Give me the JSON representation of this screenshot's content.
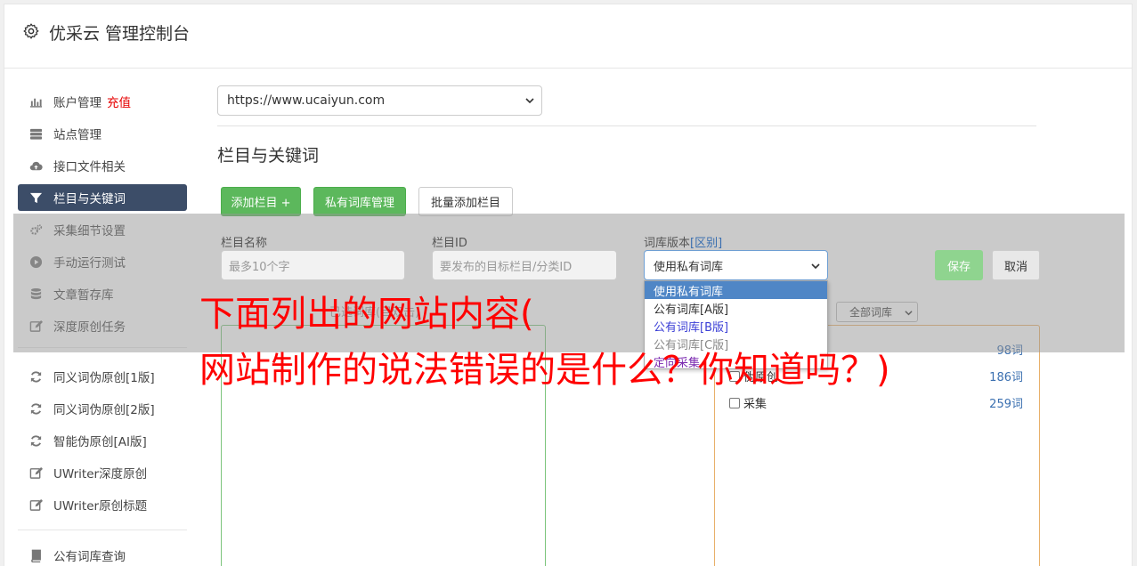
{
  "header": {
    "title": "优采云 管理控制台"
  },
  "sidebar": {
    "items": [
      {
        "label": "账户管理",
        "extra": "充值",
        "icon": "bar-chart-icon"
      },
      {
        "label": "站点管理",
        "icon": "server-icon"
      },
      {
        "label": "接口文件相关",
        "icon": "cloud-upload-icon"
      },
      {
        "label": "栏目与关键词",
        "icon": "filter-icon",
        "active": true
      },
      {
        "label": "采集细节设置",
        "icon": "gears-icon"
      },
      {
        "label": "手动运行测试",
        "icon": "play-circle-icon"
      },
      {
        "label": "文章暂存库",
        "icon": "database-icon"
      },
      {
        "label": "深度原创任务",
        "icon": "edit-icon"
      },
      {
        "label": "同义词伪原创[1版]",
        "icon": "refresh-icon"
      },
      {
        "label": "同义词伪原创[2版]",
        "icon": "refresh-icon"
      },
      {
        "label": "智能伪原创[AI版]",
        "icon": "refresh-icon"
      },
      {
        "label": "UWriter深度原创",
        "icon": "edit-icon"
      },
      {
        "label": "UWriter原创标题",
        "icon": "edit-icon"
      },
      {
        "label": "公有词库查询",
        "icon": "book-icon"
      }
    ]
  },
  "main": {
    "site_select": "https://www.ucaiyun.com",
    "section_title": "栏目与关键词",
    "buttons": {
      "add_column": "添加栏目 +",
      "private_lib": "私有词库管理",
      "batch_add": "批量添加栏目"
    },
    "form": {
      "name_label": "栏目名称",
      "name_placeholder": "最多10个字",
      "id_label": "栏目ID",
      "id_placeholder": "要发布的目标栏目/分类ID",
      "lib_label": "词库版本",
      "lib_label_link": "[区别]",
      "lib_value": "使用私有词库",
      "save": "保存",
      "cancel": "取消"
    },
    "lib_options": [
      "使用私有词库",
      "公有词库[A版]",
      "公有词库[B版]",
      "公有词库[C版]",
      "定向采集"
    ],
    "faded_label": "已选词库(目双击)",
    "lib_filter": "全部词库",
    "lib_list": [
      {
        "name": "",
        "count": "98词"
      },
      {
        "name": "伪原创",
        "count": "186词"
      },
      {
        "name": "采集",
        "count": "259词"
      }
    ]
  },
  "overlay": {
    "line1": "下面列出的网站内容(",
    "line2": "网站制作的说法错误的是什么？你知道吗？)"
  },
  "colors": {
    "active_bg": "#3c4d68",
    "green": "#5cb85c",
    "overlay_red": "#ff0000",
    "link_blue": "#3a6fb0"
  }
}
